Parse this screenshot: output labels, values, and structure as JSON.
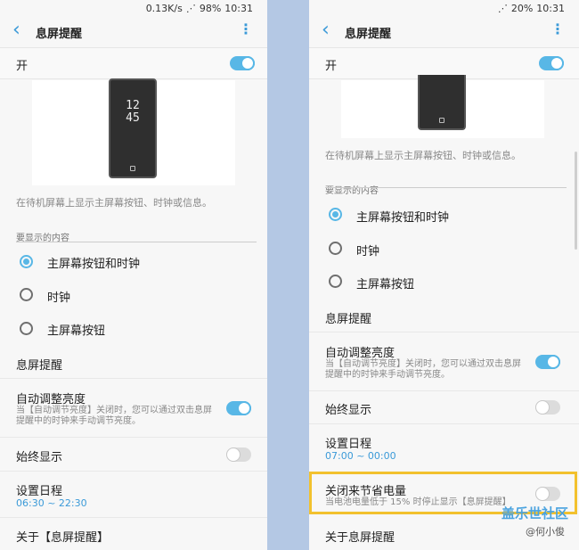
{
  "left": {
    "status": {
      "speed": "0.13K/s",
      "battery": "98%",
      "time": "10:31"
    },
    "title": "息屏提醒",
    "master_label": "开",
    "master_on": true,
    "preview_clock": [
      "12",
      "45"
    ],
    "description": "在待机屏幕上显示主屏幕按钮、时钟或信息。",
    "section_title": "要显示的内容",
    "options": [
      {
        "label": "主屏幕按钮和时钟",
        "checked": true
      },
      {
        "label": "时钟",
        "checked": false
      },
      {
        "label": "主屏幕按钮",
        "checked": false
      }
    ],
    "notify_title": "息屏提醒",
    "auto_brightness": {
      "title": "自动调整亮度",
      "sub1": "当【自动调节亮度】关闭时，您可以通过双击息屏",
      "sub2": "提醒中的时钟来手动调节亮度。",
      "on": true
    },
    "always_show": {
      "title": "始终显示",
      "on": false
    },
    "schedule": {
      "title": "设置日程",
      "value": "06:30 ~ 22:30"
    },
    "about": "关于【息屏提醒】"
  },
  "right": {
    "status": {
      "battery": "20%",
      "time": "10:31"
    },
    "title": "息屏提醒",
    "master_label": "开",
    "master_on": true,
    "description": "在待机屏幕上显示主屏幕按钮、时钟或信息。",
    "section_title": "要显示的内容",
    "options": [
      {
        "label": "主屏幕按钮和时钟",
        "checked": true
      },
      {
        "label": "时钟",
        "checked": false
      },
      {
        "label": "主屏幕按钮",
        "checked": false
      }
    ],
    "notify_title": "息屏提醒",
    "auto_brightness": {
      "title": "自动调整亮度",
      "sub1": "当【自动调节亮度】关闭时，您可以通过双击息屏",
      "sub2": "提醒中的时钟来手动调节亮度。",
      "on": true
    },
    "always_show": {
      "title": "始终显示",
      "on": false
    },
    "schedule": {
      "title": "设置日程",
      "value": "07:00 ~ 00:00"
    },
    "power_save": {
      "title": "关闭来节省电量",
      "sub": "当电池电量低于 15% 时停止显示【息屏提醒】",
      "on": false
    },
    "about": "关于息屏提醒"
  },
  "watermark": {
    "line1": "盖乐世社区",
    "line2": "@何小俊"
  },
  "colors": {
    "accent": "#3b9ad8",
    "toggle_on": "#58b7e6",
    "highlight": "#f2c12e",
    "divider_bg": "#b4c8e4"
  }
}
